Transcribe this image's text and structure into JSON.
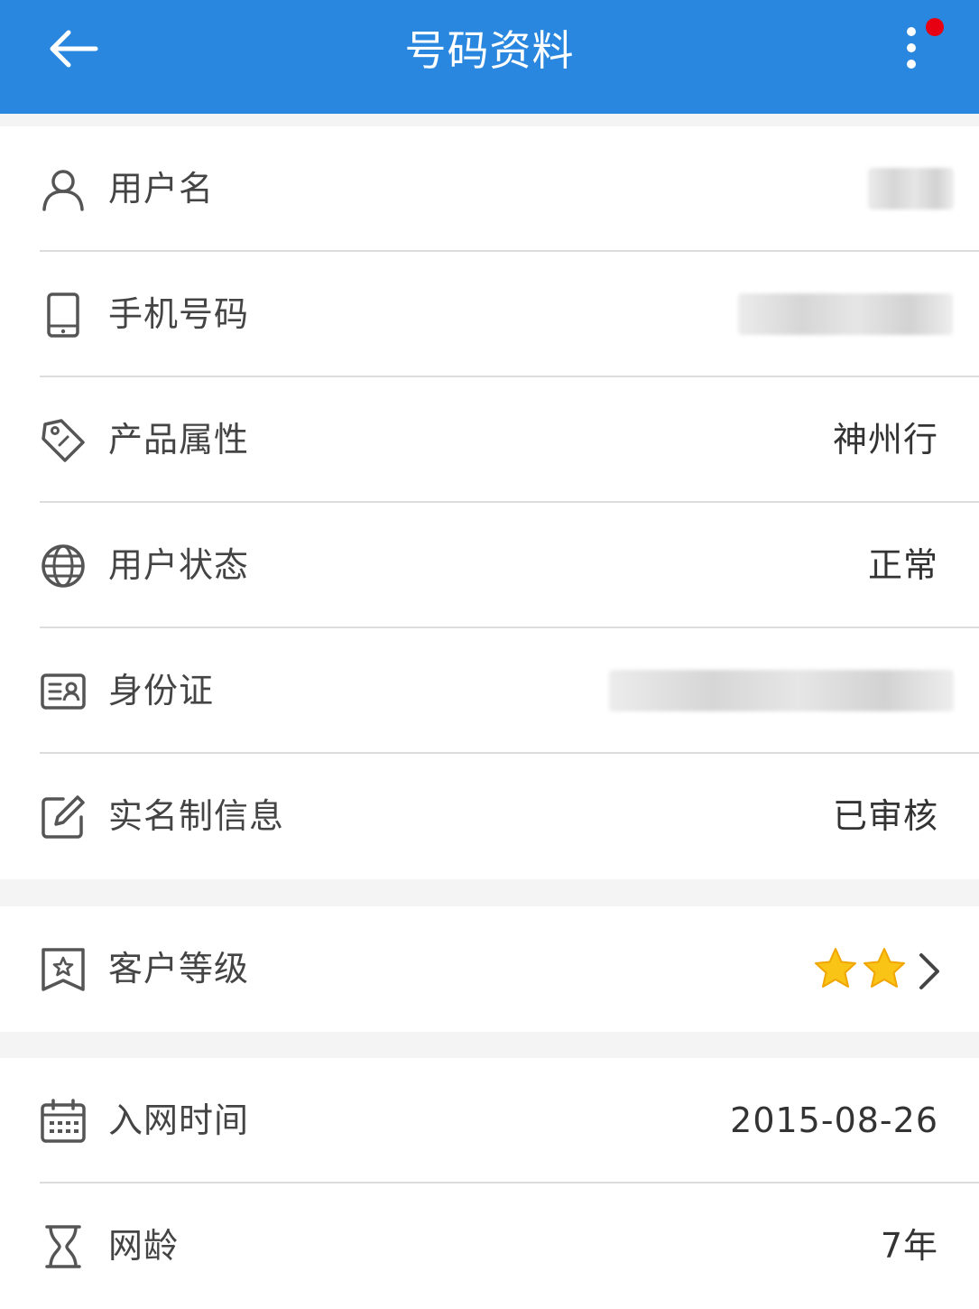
{
  "header": {
    "title": "号码资料",
    "accent_color": "#2a87df",
    "back_icon": "arrow-left-icon",
    "more_icon": "more-vertical-icon",
    "notification_dot_color": "#e60012"
  },
  "group1": [
    {
      "key": "username",
      "label": "用户名",
      "icon": "user-icon",
      "value": "",
      "masked": true
    },
    {
      "key": "phone",
      "label": "手机号码",
      "icon": "phone-icon",
      "value": "",
      "masked": true
    },
    {
      "key": "product",
      "label": "产品属性",
      "icon": "tag-icon",
      "value": "神州行"
    },
    {
      "key": "status",
      "label": "用户状态",
      "icon": "globe-icon",
      "value": "正常"
    },
    {
      "key": "id_card",
      "label": "身份证",
      "icon": "id-card-icon",
      "value": "",
      "masked": true
    },
    {
      "key": "realname",
      "label": "实名制信息",
      "icon": "edit-icon",
      "value": "已审核"
    }
  ],
  "group2": [
    {
      "key": "level",
      "label": "客户等级",
      "icon": "badge-star-icon",
      "stars": 2,
      "star_color": "#f7b500"
    }
  ],
  "group3": [
    {
      "key": "join_date",
      "label": "入网时间",
      "icon": "calendar-icon",
      "value": "2015-08-26"
    },
    {
      "key": "tenure",
      "label": "网龄",
      "icon": "hourglass-icon",
      "value": "7年"
    }
  ]
}
